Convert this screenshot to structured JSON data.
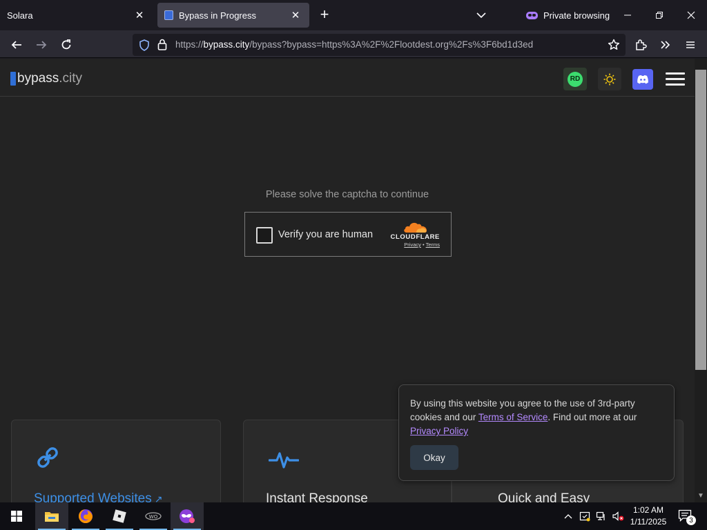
{
  "browser": {
    "tabs": [
      {
        "title": "Solara"
      },
      {
        "title": "Bypass in Progress"
      }
    ],
    "private_label": "Private browsing",
    "url": {
      "prefix": "https://",
      "domain": "bypass.city",
      "path": "/bypass?bypass=https%3A%2F%2Flootdest.org%2Fs%3F6bd1d3ed"
    }
  },
  "site": {
    "logo_first": "bypass",
    "logo_second": ".city",
    "header_buttons": {
      "avatar_initials": "RD"
    },
    "captcha_prompt": "Please solve the captcha to continue",
    "captcha": {
      "checkbox_label": "Verify you are human",
      "brand": "CLOUDFLARE",
      "privacy_link": "Privacy",
      "separator": "•",
      "terms_link": "Terms"
    },
    "cards": [
      {
        "title": "Supported Websites"
      },
      {
        "title": "Instant Response"
      },
      {
        "title": "Quick and Easy"
      }
    ],
    "cookie_banner": {
      "text_1": "By using this website you agree to the use of 3rd-party cookies and our ",
      "tos_link": "Terms of Service",
      "text_2": ". Find out more at our ",
      "privacy_link": "Privacy Policy",
      "button": "Okay"
    }
  },
  "taskbar": {
    "time": "1:02 AM",
    "date": "1/11/2025",
    "notification_count": "3"
  },
  "colors": {
    "accent_blue": "#3d8fe6",
    "discord": "#5865f2",
    "cloudflare_orange": "#f38020",
    "link_purple": "#b48aff"
  }
}
